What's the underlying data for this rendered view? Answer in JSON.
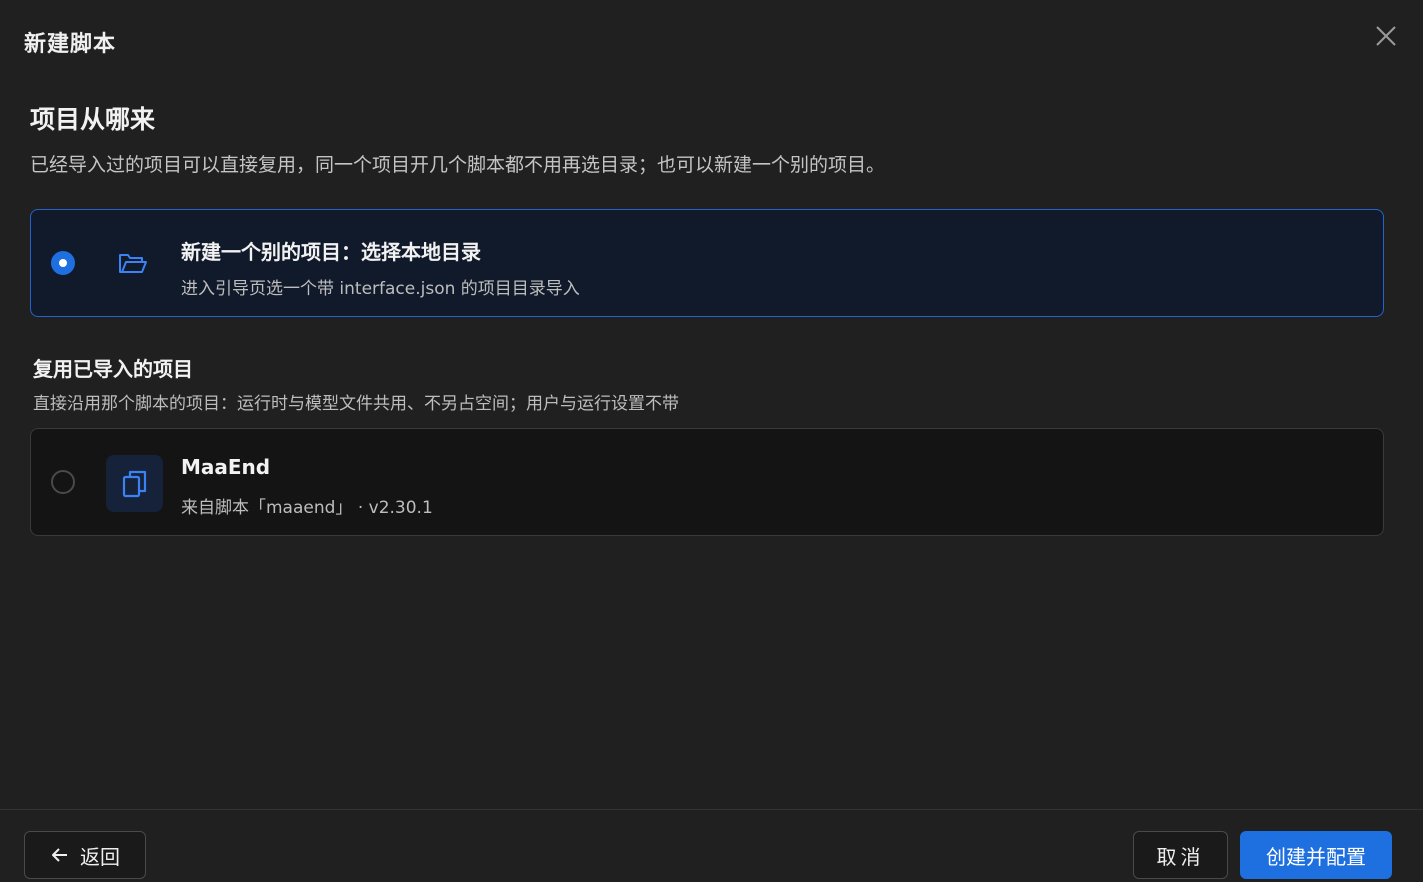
{
  "dialog": {
    "title": "新建脚本"
  },
  "source_section": {
    "heading": "项目从哪来",
    "description": "已经导入过的项目可以直接复用，同一个项目开几个脚本都不用再选目录；也可以新建一个别的项目。"
  },
  "new_project_option": {
    "title": "新建一个别的项目：选择本地目录",
    "subtitle": "进入引导页选一个带 interface.json 的项目目录导入",
    "selected": true,
    "icon": "folder-open-icon"
  },
  "reuse_section": {
    "heading": "复用已导入的项目",
    "description": "直接沿用那个脚本的项目：运行时与模型文件共用、不另占空间；用户与运行设置不带"
  },
  "imported_projects": [
    {
      "name": "MaaEnd",
      "source": "来自脚本「maaend」 · v2.30.1",
      "selected": false,
      "icon": "copy-document-icon"
    }
  ],
  "footer": {
    "back_label": "返回",
    "cancel_label": "取消",
    "create_label": "创建并配置"
  },
  "colors": {
    "accent": "#1e6fe0",
    "background": "#202020",
    "selected_card_bg": "#111a2b",
    "selected_card_border": "#2563c9"
  }
}
